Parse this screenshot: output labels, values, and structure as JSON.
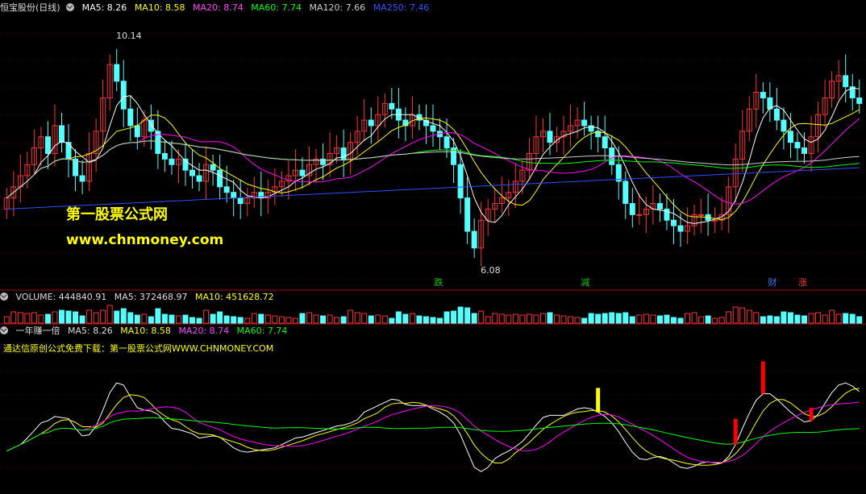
{
  "main_header": {
    "title": "恒宝股份(日线)",
    "ma5": "MA5: 8.26",
    "ma10": "MA10: 8.58",
    "ma20": "MA20: 8.74",
    "ma60": "MA60: 7.74",
    "ma120": "MA120: 7.66",
    "ma250": "MA250: 7.46"
  },
  "volume_header": {
    "volume": "VOLUME: 444840.91",
    "ma5": "MA5: 372468.97",
    "ma10": "MA10: 451628.72"
  },
  "indicator_header": {
    "title": "一年赚一倍",
    "ma5": "MA5: 8.26",
    "ma10": "MA10: 8.58",
    "ma20": "MA20: 8.74",
    "ma60": "MA60: 7.74"
  },
  "indicator_note": "通达信原创公式免费下载：第一股票公式网WWW.CHNMONEY.COM",
  "watermark": {
    "line1": "第一股票公式网",
    "line2": "www.chnmoney.com"
  },
  "colors": {
    "up": "#ff3333",
    "down": "#54ffff",
    "ma5": "#ffffff",
    "ma10": "#ffff00",
    "ma20": "#ff00ff",
    "ma60": "#00ff00",
    "ma120": "#cccccc",
    "ma250": "#3050ff"
  },
  "chart_data": {
    "type": "candlestick",
    "high_label": "10.14",
    "low_label": "6.08",
    "ylim": [
      5.6,
      10.5
    ],
    "signals": [
      {
        "text": "跌",
        "index": 85,
        "color": "#00cc00"
      },
      {
        "text": "减",
        "index": 114,
        "color": "#00cc00"
      },
      {
        "text": "财",
        "index": 151,
        "color": "#3377ff"
      },
      {
        "text": "涨",
        "index": 157,
        "color": "#ff3333"
      }
    ],
    "closes": [
      7.2,
      7.4,
      7.6,
      7.8,
      8.1,
      8.3,
      8.0,
      8.5,
      8.2,
      7.9,
      7.6,
      7.5,
      8.0,
      8.4,
      9.0,
      9.6,
      9.3,
      8.8,
      8.5,
      8.3,
      8.6,
      8.4,
      8.0,
      7.9,
      7.8,
      7.9,
      7.7,
      7.6,
      7.5,
      7.8,
      7.7,
      7.4,
      7.3,
      7.2,
      7.1,
      7.2,
      7.3,
      7.2,
      7.3,
      7.4,
      7.5,
      7.6,
      7.7,
      7.6,
      7.8,
      7.9,
      7.8,
      8.0,
      8.1,
      7.9,
      8.2,
      8.4,
      8.6,
      8.5,
      8.7,
      8.9,
      8.8,
      8.6,
      8.5,
      8.7,
      8.6,
      8.5,
      8.4,
      8.3,
      8.1,
      7.8,
      7.2,
      6.6,
      6.3,
      6.8,
      7.0,
      7.1,
      7.2,
      7.3,
      7.5,
      7.7,
      8.0,
      8.3,
      8.4,
      8.2,
      8.3,
      8.4,
      8.5,
      8.6,
      8.5,
      8.4,
      8.3,
      8.1,
      7.8,
      7.5,
      7.1,
      6.9,
      6.9,
      7.0,
      7.1,
      7.0,
      6.8,
      6.7,
      6.6,
      6.7,
      6.9,
      6.9,
      6.8,
      6.8,
      6.9,
      7.4,
      7.9,
      8.4,
      8.8,
      9.1,
      9.0,
      8.8,
      8.6,
      8.4,
      8.2,
      8.1,
      8.0,
      8.3,
      8.7,
      9.0,
      9.3,
      9.4,
      9.2,
      9.0,
      8.9
    ],
    "opens": [
      7.0,
      7.2,
      7.4,
      7.6,
      7.8,
      8.1,
      8.3,
      8.0,
      8.5,
      8.2,
      7.9,
      7.6,
      7.5,
      8.0,
      8.4,
      9.0,
      9.6,
      9.3,
      8.8,
      8.5,
      8.3,
      8.6,
      8.4,
      8.0,
      7.9,
      7.8,
      7.9,
      7.7,
      7.6,
      7.5,
      7.8,
      7.7,
      7.4,
      7.3,
      7.2,
      7.1,
      7.2,
      7.3,
      7.2,
      7.3,
      7.4,
      7.5,
      7.6,
      7.7,
      7.6,
      7.8,
      7.9,
      7.8,
      8.0,
      8.1,
      7.9,
      8.2,
      8.4,
      8.6,
      8.5,
      8.7,
      8.9,
      8.8,
      8.6,
      8.5,
      8.7,
      8.6,
      8.5,
      8.4,
      8.3,
      8.1,
      7.8,
      7.2,
      6.6,
      6.3,
      6.8,
      7.0,
      7.1,
      7.2,
      7.3,
      7.5,
      7.7,
      8.0,
      8.3,
      8.4,
      8.2,
      8.3,
      8.4,
      8.5,
      8.6,
      8.5,
      8.4,
      8.3,
      8.1,
      7.8,
      7.5,
      7.1,
      6.9,
      6.9,
      7.0,
      7.1,
      7.0,
      6.8,
      6.7,
      6.6,
      6.7,
      6.9,
      6.9,
      6.8,
      6.8,
      6.9,
      7.4,
      7.9,
      8.4,
      8.8,
      9.1,
      9.0,
      8.8,
      8.6,
      8.4,
      8.2,
      8.1,
      8.0,
      8.3,
      8.7,
      9.0,
      9.3,
      9.4,
      9.2,
      9.0
    ]
  }
}
